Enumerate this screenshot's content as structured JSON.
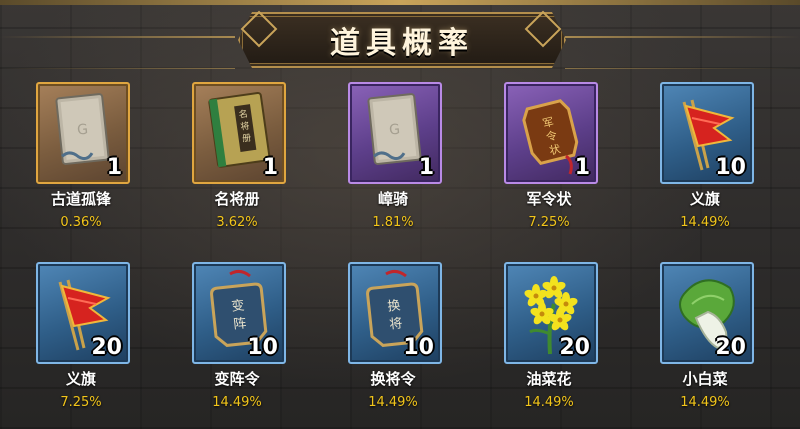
{
  "title": "道具概率",
  "colors": {
    "accent_gold": "#c9a45a",
    "probability_text": "#f2c51a",
    "frame_orange": "#e0a640",
    "frame_purple": "#b98ae6",
    "frame_blue": "#7fb6e6"
  },
  "items": [
    {
      "name": "古道孤锋",
      "count": "1",
      "probability": "0.36%",
      "rarity": "orange",
      "icon": "blank-card-icon"
    },
    {
      "name": "名将册",
      "count": "1",
      "probability": "3.62%",
      "rarity": "orange",
      "icon": "book-icon",
      "icon_text": "名将册"
    },
    {
      "name": "嶂骑",
      "count": "1",
      "probability": "1.81%",
      "rarity": "purple",
      "icon": "blank-card-icon"
    },
    {
      "name": "军令状",
      "count": "1",
      "probability": "7.25%",
      "rarity": "purple",
      "icon": "order-token-icon",
      "icon_text": "军令状"
    },
    {
      "name": "义旗",
      "count": "10",
      "probability": "14.49%",
      "rarity": "blue",
      "icon": "red-flag-icon"
    },
    {
      "name": "义旗",
      "count": "20",
      "probability": "7.25%",
      "rarity": "blue",
      "icon": "red-flag-icon"
    },
    {
      "name": "变阵令",
      "count": "10",
      "probability": "14.49%",
      "rarity": "blue",
      "icon": "token-plaque-icon",
      "icon_text": "变阵"
    },
    {
      "name": "换将令",
      "count": "10",
      "probability": "14.49%",
      "rarity": "blue",
      "icon": "token-plaque-icon",
      "icon_text": "换将"
    },
    {
      "name": "油菜花",
      "count": "20",
      "probability": "14.49%",
      "rarity": "blue",
      "icon": "rapeseed-flower-icon"
    },
    {
      "name": "小白菜",
      "count": "20",
      "probability": "14.49%",
      "rarity": "blue",
      "icon": "bok-choy-icon"
    }
  ]
}
